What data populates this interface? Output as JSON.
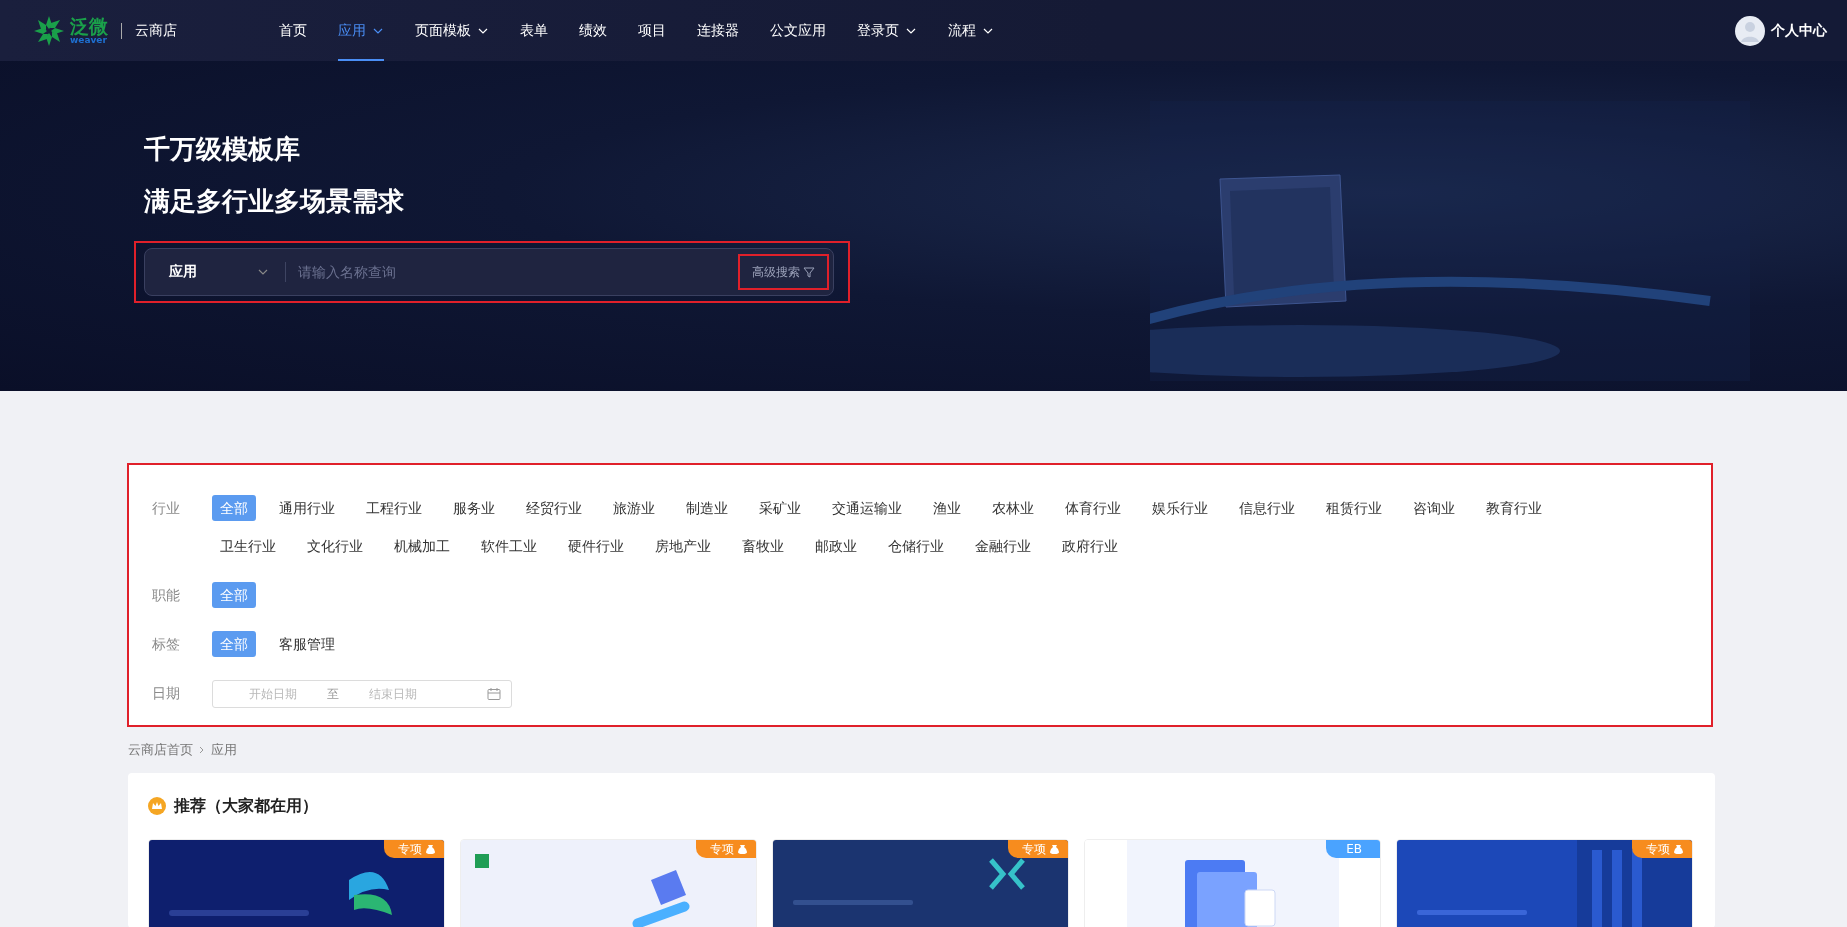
{
  "nav": {
    "logo_text": "泛微",
    "logo_subtext": "weaver",
    "store_name": "云商店",
    "items": [
      {
        "label": "首页",
        "selected": false,
        "dropdown": false
      },
      {
        "label": "应用",
        "selected": true,
        "dropdown": true
      },
      {
        "label": "页面模板",
        "selected": false,
        "dropdown": true
      },
      {
        "label": "表单",
        "selected": false,
        "dropdown": false
      },
      {
        "label": "绩效",
        "selected": false,
        "dropdown": false
      },
      {
        "label": "项目",
        "selected": false,
        "dropdown": false
      },
      {
        "label": "连接器",
        "selected": false,
        "dropdown": false
      },
      {
        "label": "公文应用",
        "selected": false,
        "dropdown": false
      },
      {
        "label": "登录页",
        "selected": false,
        "dropdown": true
      },
      {
        "label": "流程",
        "selected": false,
        "dropdown": true
      }
    ],
    "user": "个人中心"
  },
  "hero": {
    "headline": [
      "千万级模板库",
      "满足多行业多场景需求"
    ],
    "search": {
      "type": "应用",
      "placeholder": "请输入名称查询",
      "advanced": "高级搜索"
    }
  },
  "filters": [
    {
      "label": "行业",
      "options": [
        {
          "label": "全部",
          "selected": true
        },
        {
          "label": "通用行业",
          "selected": false
        },
        {
          "label": "工程行业",
          "selected": false
        },
        {
          "label": "服务业",
          "selected": false
        },
        {
          "label": "经贸行业",
          "selected": false
        },
        {
          "label": "旅游业",
          "selected": false
        },
        {
          "label": "制造业",
          "selected": false
        },
        {
          "label": "采矿业",
          "selected": false
        },
        {
          "label": "交通运输业",
          "selected": false
        },
        {
          "label": "渔业",
          "selected": false
        },
        {
          "label": "农林业",
          "selected": false
        },
        {
          "label": "体育行业",
          "selected": false
        },
        {
          "label": "娱乐行业",
          "selected": false
        },
        {
          "label": "信息行业",
          "selected": false
        },
        {
          "label": "租赁行业",
          "selected": false
        },
        {
          "label": "咨询业",
          "selected": false
        },
        {
          "label": "教育行业",
          "selected": false
        },
        {
          "label": "卫生行业",
          "selected": false
        },
        {
          "label": "文化行业",
          "selected": false
        },
        {
          "label": "机械加工",
          "selected": false
        },
        {
          "label": "软件工业",
          "selected": false
        },
        {
          "label": "硬件行业",
          "selected": false
        },
        {
          "label": "房地产业",
          "selected": false
        },
        {
          "label": "畜牧业",
          "selected": false
        },
        {
          "label": "邮政业",
          "selected": false
        },
        {
          "label": "仓储行业",
          "selected": false
        },
        {
          "label": "金融行业",
          "selected": false
        },
        {
          "label": "政府行业",
          "selected": false
        }
      ]
    },
    {
      "label": "职能",
      "options": [
        {
          "label": "全部",
          "selected": true
        }
      ]
    },
    {
      "label": "标签",
      "options": [
        {
          "label": "全部",
          "selected": true
        },
        {
          "label": "客服管理",
          "selected": false
        }
      ]
    }
  ],
  "date": {
    "label": "日期",
    "start_placeholder": "开始日期",
    "separator": "至",
    "end_placeholder": "结束日期"
  },
  "breadcrumb": [
    "云商店首页",
    "应用"
  ],
  "recommend": {
    "title": "推荐（大家都在用）",
    "cards": [
      {
        "badge": "专项",
        "kind": "special"
      },
      {
        "badge": "专项",
        "kind": "special"
      },
      {
        "badge": "专项",
        "kind": "special"
      },
      {
        "badge": "EB",
        "kind": "eb"
      },
      {
        "badge": "专项",
        "kind": "special"
      }
    ]
  }
}
